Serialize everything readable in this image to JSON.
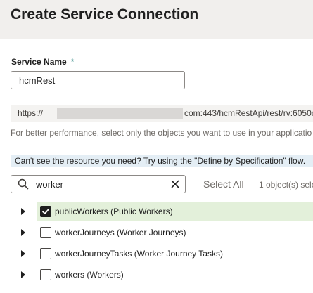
{
  "header": {
    "title": "Create Service Connection"
  },
  "service_name": {
    "label": "Service Name",
    "required_marker": "*",
    "value": "hcmRest"
  },
  "url": {
    "prefix": "https://",
    "suffix": "com:443/hcmRestApi/rest/rv:6050c"
  },
  "help_text": "For better performance, select only the objects you want to use in your applicatio",
  "info_banner": "Can't see the resource you need? Try using the \"Define by Specification\" flow.",
  "search": {
    "value": "worker"
  },
  "select_all_label": "Select All",
  "count_label": "1 object(s) sele",
  "objects": [
    {
      "label": "publicWorkers (Public Workers)",
      "checked": true
    },
    {
      "label": "workerJourneys (Worker Journeys)",
      "checked": false
    },
    {
      "label": "workerJourneyTasks (Worker Journey Tasks)",
      "checked": false
    },
    {
      "label": "workers (Workers)",
      "checked": false
    }
  ],
  "colors": {
    "header_bg": "#f1efed",
    "selected_row_bg": "#e3f0da",
    "info_banner_bg": "#e4eef5",
    "required_marker": "#3b8e8a"
  }
}
